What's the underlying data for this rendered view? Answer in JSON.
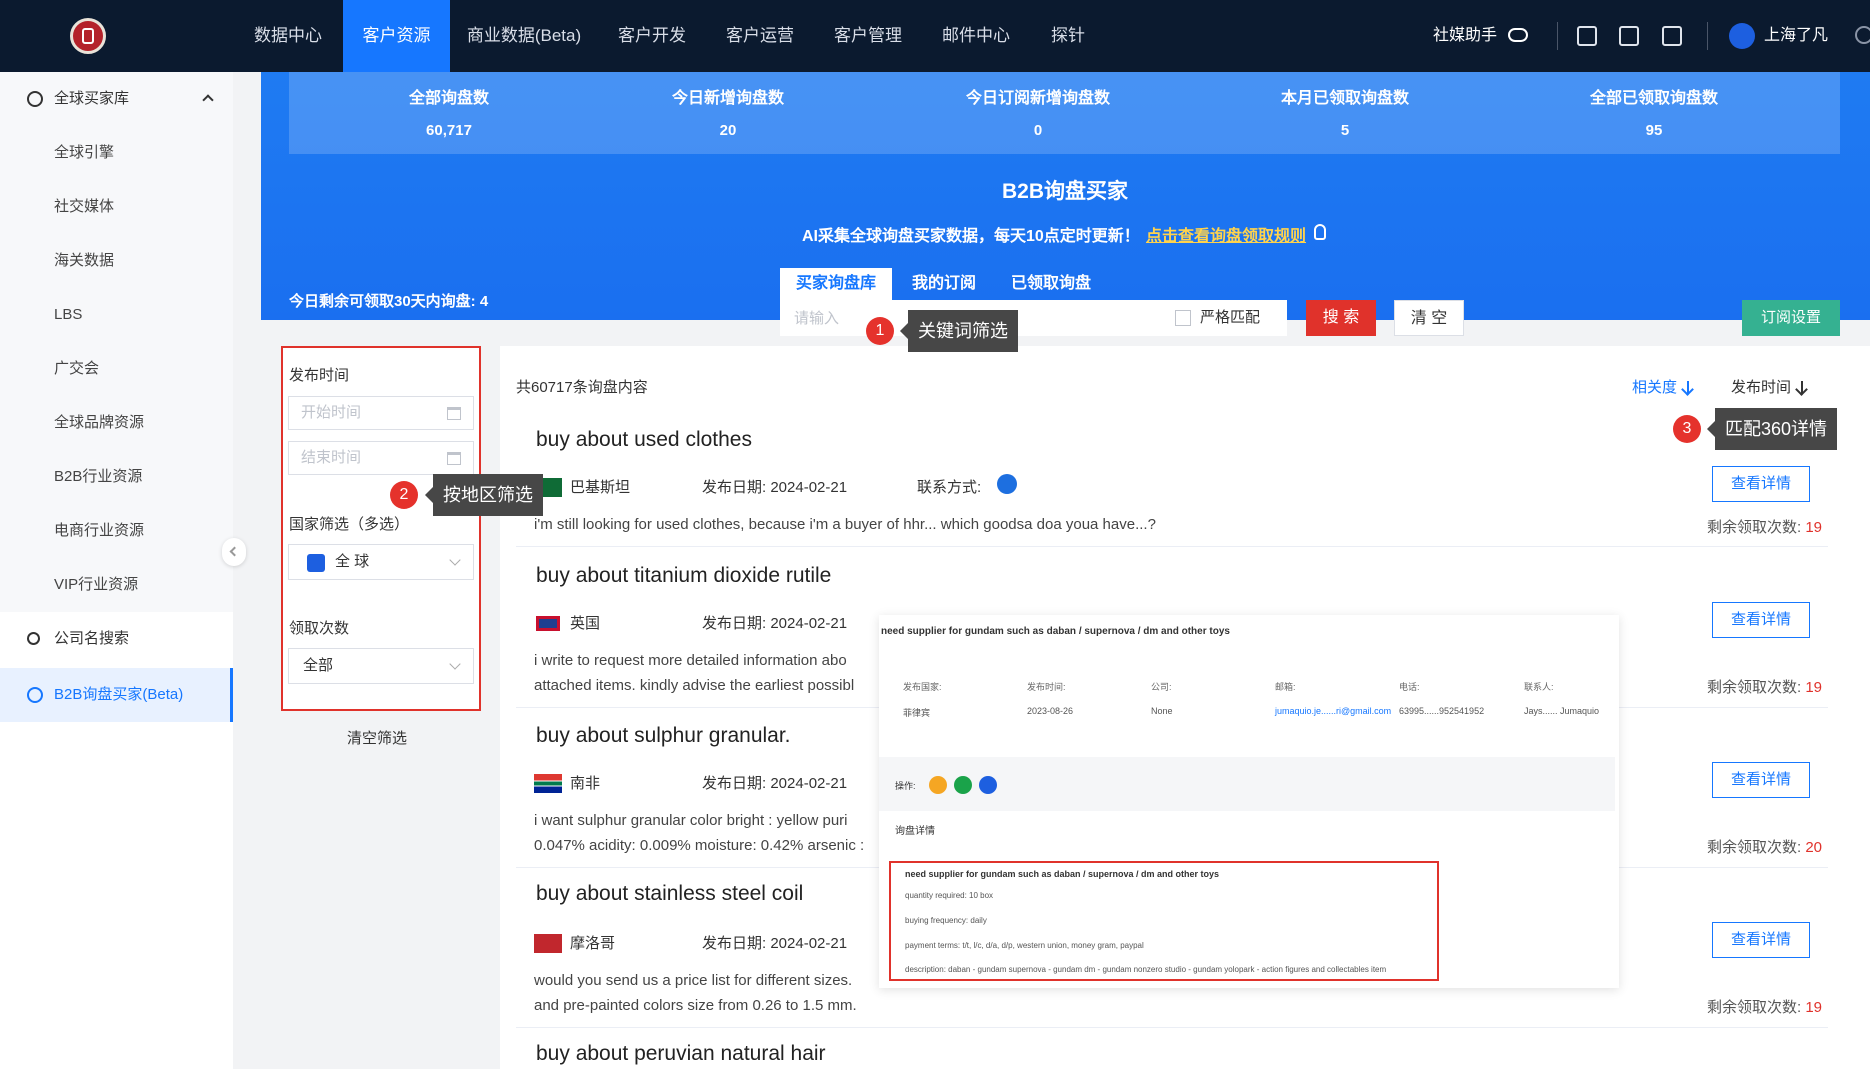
{
  "nav": {
    "items": [
      "数据中心",
      "客户资源",
      "商业数据(Beta)",
      "客户开发",
      "客户运营",
      "客户管理",
      "邮件中心",
      "探针"
    ],
    "active_index": 1,
    "social_helper": "社媒助手",
    "user_name": "上海了凡"
  },
  "sidebar": {
    "group_title": "全球买家库",
    "sub_items": [
      "全球引擎",
      "社交媒体",
      "海关数据",
      "LBS",
      "广交会",
      "全球品牌资源",
      "B2B行业资源",
      "电商行业资源",
      "VIP行业资源"
    ],
    "company_search": "公司名搜索",
    "b2b_buyer": "B2B询盘买家(Beta)"
  },
  "stats": [
    {
      "label": "全部询盘数",
      "value": "60,717"
    },
    {
      "label": "今日新增询盘数",
      "value": "20"
    },
    {
      "label": "今日订阅新增询盘数",
      "value": "0"
    },
    {
      "label": "本月已领取询盘数",
      "value": "5"
    },
    {
      "label": "全部已领取询盘数",
      "value": "95"
    }
  ],
  "hero": {
    "title": "B2B询盘买家",
    "subtitle": "AI采集全球询盘买家数据，每天10点定时更新！",
    "rule_link": "点击查看询盘领取规则",
    "remaining_today": "今日剩余可领取30天内询盘: 4"
  },
  "tabs": [
    "买家询盘库",
    "我的订阅",
    "已领取询盘"
  ],
  "search": {
    "placeholder": "请输入",
    "strict_match": "严格匹配",
    "search_button": "搜 索",
    "clear_button": "清 空",
    "subscribe_button": "订阅设置"
  },
  "filters": {
    "publish_time": "发布时间",
    "start_placeholder": "开始时间",
    "end_placeholder": "结束时间",
    "country_label": "国家筛选（多选）",
    "country_value": "全 球",
    "count_label": "领取次数",
    "count_value": "全部",
    "clear": "清空筛选"
  },
  "list": {
    "total": "共60717条询盘内容",
    "sort_relevance": "相关度",
    "sort_time": "发布时间",
    "date_label": "发布日期:",
    "contact_label": "联系方式:",
    "view_label": "查看详情",
    "remaining_label": "剩余领取次数:",
    "items": [
      {
        "title": "buy about used clothes",
        "country": "巴基斯坦",
        "date": "2024-02-21",
        "desc1": "i'm still looking for used clothes, because i'm a buyer of hhr... which goodsa doa youa have...?",
        "desc2": "",
        "remaining": "19"
      },
      {
        "title": "buy about titanium dioxide rutile",
        "country": "英国",
        "date": "2024-02-21",
        "desc1": "i write to request more detailed information abo",
        "desc2": "attached items. kindly advise the earliest possibl",
        "remaining": "19"
      },
      {
        "title": "buy about sulphur granular.",
        "country": "南非",
        "date": "2024-02-21",
        "desc1": "i want sulphur granular color bright : yellow puri",
        "desc2": "0.047% acidity: 0.009% moisture: 0.42% arsenic :",
        "remaining": "20"
      },
      {
        "title": "buy about stainless steel coil",
        "country": "摩洛哥",
        "date": "2024-02-21",
        "desc1": "would you send us a price list for different sizes.",
        "desc2": "and pre-painted colors size from 0.26 to 1.5 mm.",
        "remaining": "19"
      },
      {
        "title": "buy about peruvian natural hair",
        "country": "",
        "date": "",
        "desc1": "",
        "desc2": "",
        "remaining": ""
      }
    ]
  },
  "detail_popup": {
    "title": "need supplier for gundam such as daban / supernova / dm and other toys",
    "fields": [
      {
        "label": "发布国家:",
        "value": "菲律宾"
      },
      {
        "label": "发布时间:",
        "value": "2023-08-26"
      },
      {
        "label": "公司:",
        "value": "None"
      },
      {
        "label": "邮箱:",
        "value": "jumaquio.je......ri@gmail.com"
      },
      {
        "label": "电话:",
        "value": "63995......952541952"
      },
      {
        "label": "联系人:",
        "value": "Jays...... Jumaquio"
      }
    ],
    "ops_label": "操作:",
    "detail_label": "询盘详情",
    "box_title": "need supplier for gundam such as daban / supernova / dm and other toys",
    "lines": [
      "quantity required:  10 box",
      "buying frequency:  daily",
      "payment terms:  t/t, l/c, d/a, d/p, western union, money gram, paypal",
      "description:  daban - gundam supernova - gundam dm - gundam nonzero studio - gundam yolopark - action figures and collectables item"
    ]
  },
  "annotations": [
    {
      "num": "1",
      "text": "关键词筛选"
    },
    {
      "num": "2",
      "text": "按地区筛选"
    },
    {
      "num": "3",
      "text": "匹配360详情"
    }
  ],
  "colors": {
    "nav_bg": "#0b1a2f",
    "accent": "#1677ff",
    "danger": "#e0322b",
    "success": "#35b191"
  }
}
